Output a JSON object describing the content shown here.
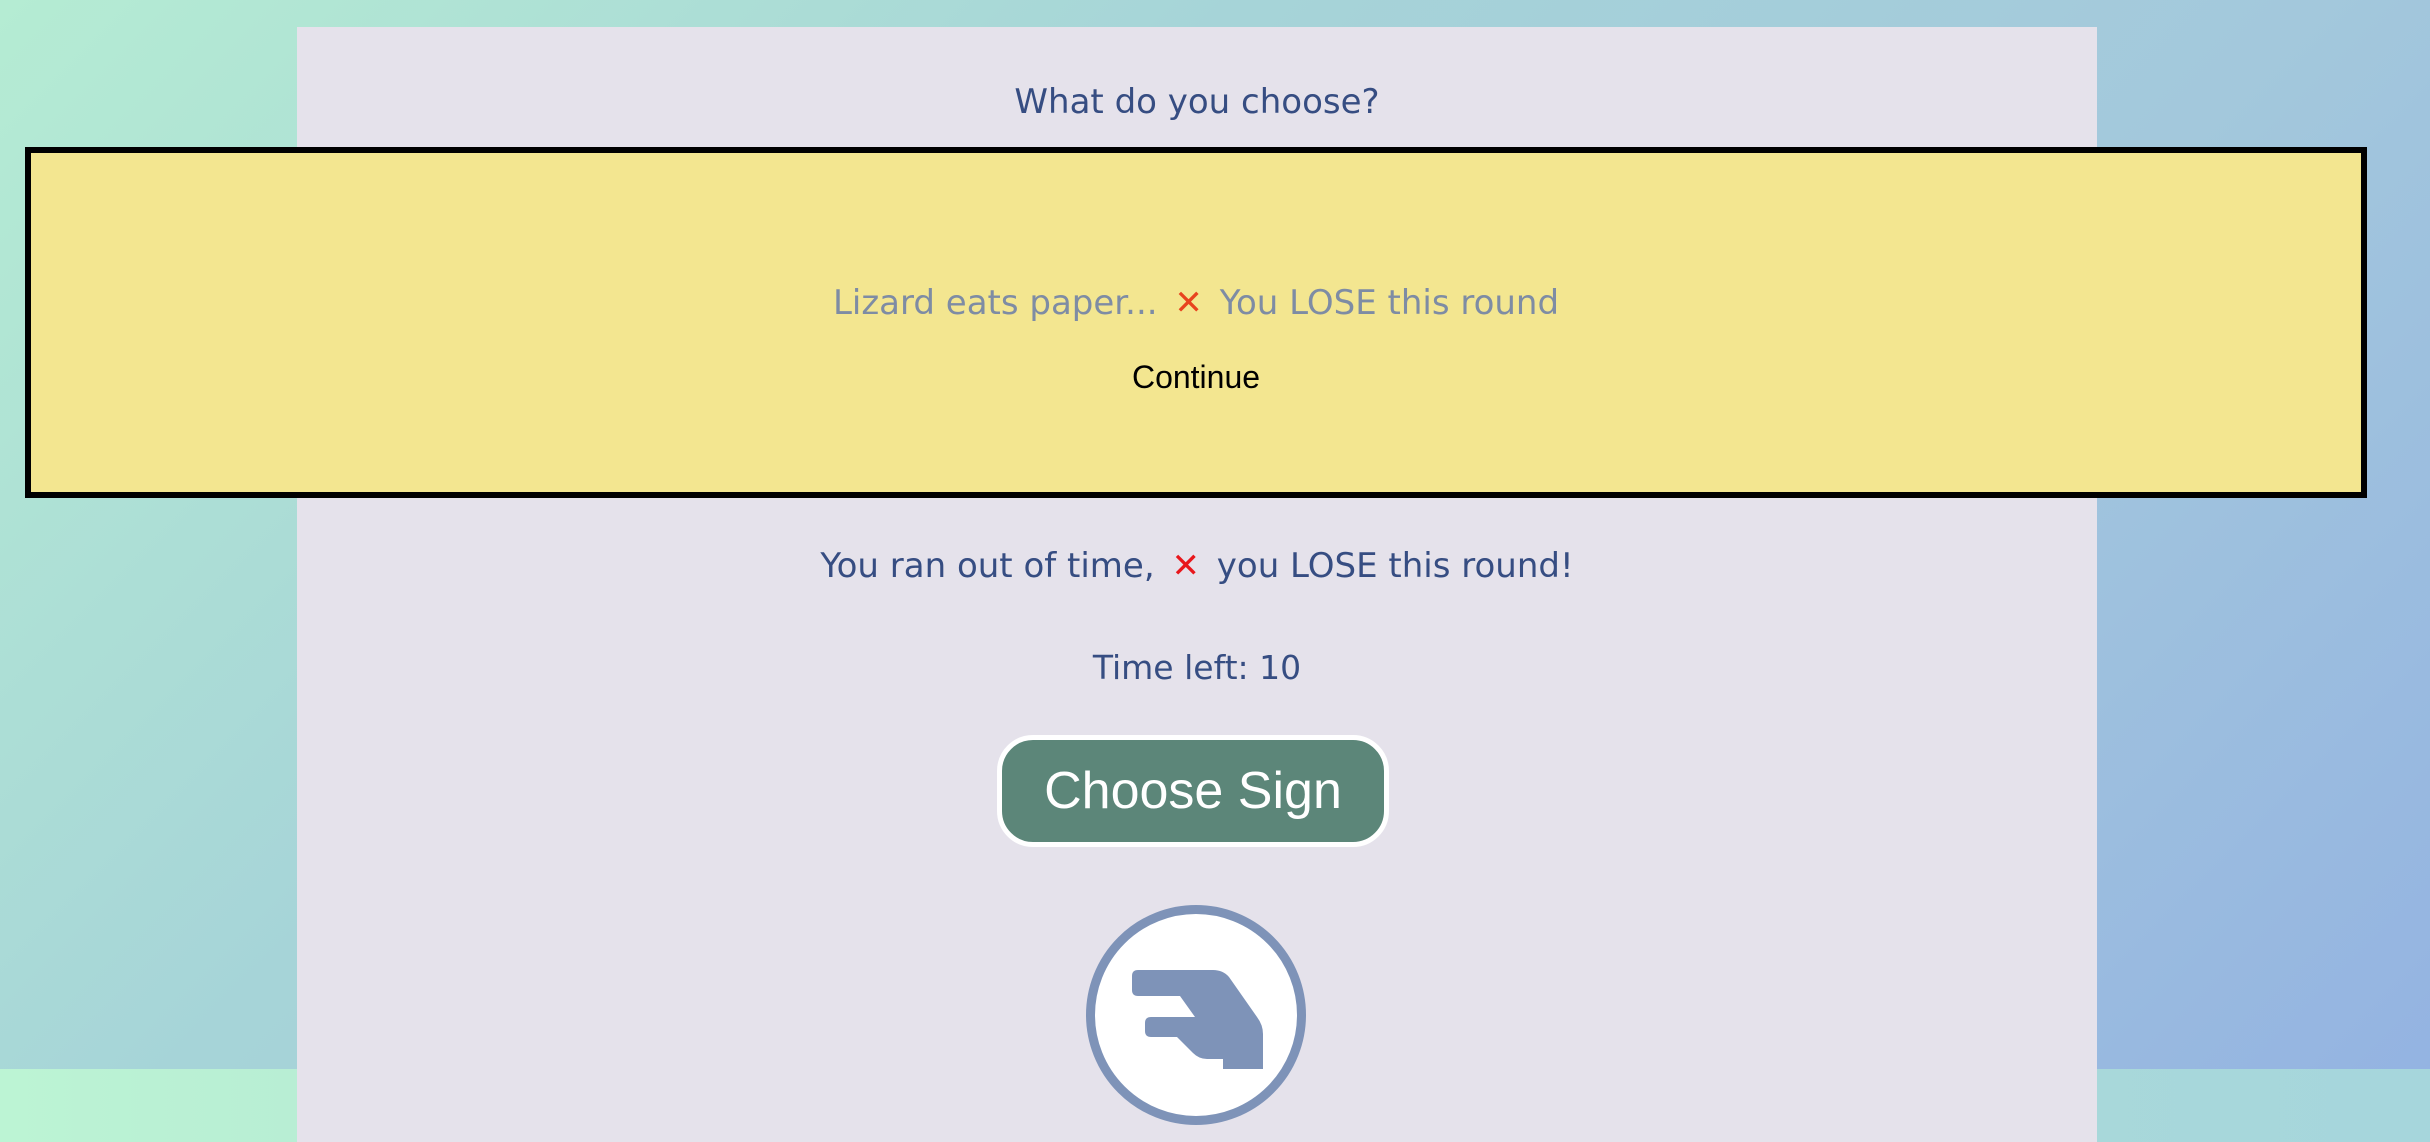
{
  "game": {
    "question": "What do you choose?",
    "status_prefix": "You ran out of time,",
    "status_suffix": "you LOSE this round!",
    "timer_label": "Time left: 10",
    "choose_button": "Choose Sign",
    "current_sign_icon": "lizard-hand-icon"
  },
  "modal": {
    "message_prefix": "Lizard eats paper...",
    "message_suffix": "You LOSE this round",
    "continue_label": "Continue"
  },
  "symbols": {
    "cross": "✕"
  },
  "colors": {
    "panel_background": "#e5e2eb",
    "text_primary": "#364d82",
    "modal_background": "#f3e690",
    "modal_text": "#7e8ca4",
    "button_background": "#5c8679",
    "sign_icon": "#7e93b8",
    "cross_red": "#e8171c"
  }
}
